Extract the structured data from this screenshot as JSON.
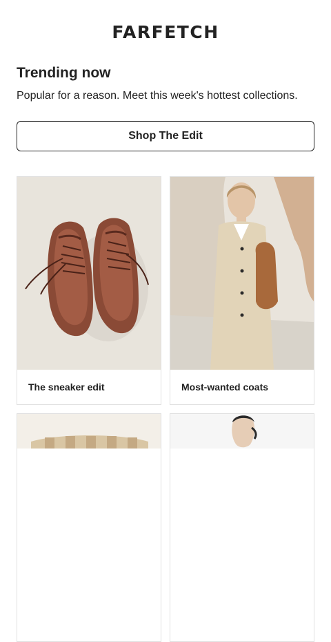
{
  "brand": {
    "logo_text": "FARFETCH"
  },
  "section": {
    "title": "Trending now",
    "subtitle": "Popular for a reason. Meet this week's hottest collections.",
    "cta_label": "Shop The Edit"
  },
  "cards": [
    {
      "caption": "The sneaker edit",
      "image": "brown-satin-sneakers-photo"
    },
    {
      "caption": "Most-wanted coats",
      "image": "woman-in-cream-coat-photo"
    },
    {
      "caption": "",
      "image": "striped-product-photo"
    },
    {
      "caption": "",
      "image": "model-portrait-photo"
    }
  ],
  "colors": {
    "text": "#222222",
    "border": "#e0e0e0",
    "background": "#ffffff"
  }
}
